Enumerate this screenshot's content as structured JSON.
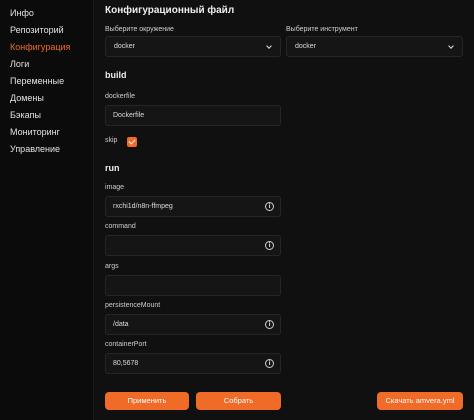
{
  "sidebar": {
    "items": [
      {
        "label": "Инфо"
      },
      {
        "label": "Репозиторий"
      },
      {
        "label": "Конфигурация",
        "active": true
      },
      {
        "label": "Логи"
      },
      {
        "label": "Переменные"
      },
      {
        "label": "Домены"
      },
      {
        "label": "Бэкапы"
      },
      {
        "label": "Мониторинг"
      },
      {
        "label": "Управление"
      }
    ]
  },
  "main": {
    "title": "Конфигурационный файл",
    "environment": {
      "label": "Выберите окружение",
      "value": "docker"
    },
    "tool": {
      "label": "Выберите инструмент",
      "value": "docker"
    },
    "build": {
      "heading": "build",
      "dockerfile": {
        "label": "dockerfile",
        "value": "Dockerfile"
      },
      "skip": {
        "label": "skip",
        "checked": true
      }
    },
    "run": {
      "heading": "run",
      "image": {
        "label": "image",
        "value": "rxchi1d/n8n-ffmpeg"
      },
      "command": {
        "label": "command",
        "value": ""
      },
      "args": {
        "label": "args",
        "value": ""
      },
      "persistenceMount": {
        "label": "persistenceMount",
        "value": "/data"
      },
      "containerPort": {
        "label": "containerPort",
        "value": "80,5678"
      }
    },
    "buttons": {
      "apply": "Применить",
      "build": "Собрать",
      "download": "Скачать amvera.yml"
    }
  },
  "colors": {
    "accent": "#f06a28",
    "background": "#101010",
    "field": "#151515"
  },
  "icons": {
    "info": "info-circle-icon",
    "dropdown": "chevron-down-icon",
    "checkbox": "checkmark-icon"
  }
}
